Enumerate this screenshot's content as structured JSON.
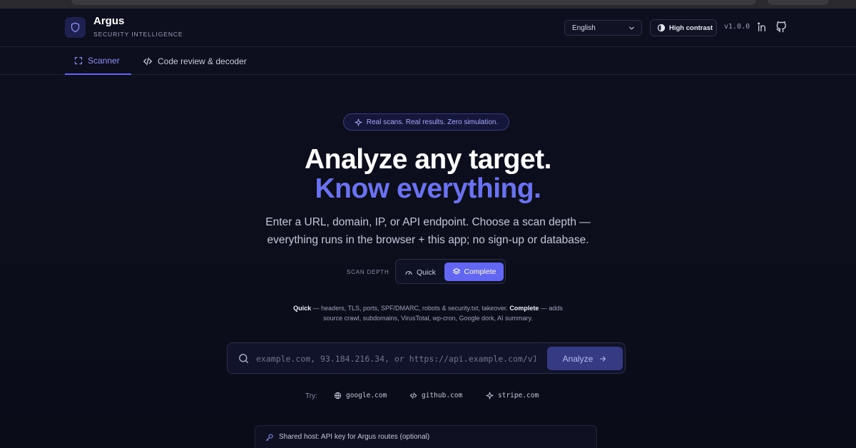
{
  "header": {
    "brand_name": "Argus",
    "brand_subtitle": "SECURITY INTELLIGENCE",
    "language": "English",
    "contrast_label": "High contrast",
    "version": "v1.0.0"
  },
  "tabs": [
    {
      "label": "Scanner",
      "active": true
    },
    {
      "label": "Code review & decoder",
      "active": false
    }
  ],
  "hero": {
    "badge": "Real scans. Real results. Zero simulation.",
    "title_line1": "Analyze any target.",
    "title_line2": "Know everything.",
    "subtitle_line1": "Enter a URL, domain, IP, or API endpoint. Choose a scan depth —",
    "subtitle_line2": "everything runs in the browser + this app; no sign-up or database."
  },
  "scan_depth": {
    "label": "SCAN DEPTH",
    "options": [
      "Quick",
      "Complete"
    ],
    "selected": "Complete",
    "desc_quick_title": "Quick",
    "desc_quick_text": " — headers, TLS, ports, SPF/DMARC, robots & security.txt, takeover. ",
    "desc_complete_title": "Complete",
    "desc_complete_text": " — adds",
    "desc_line2": "source crawl, subdomains, VirusTotal, wp-cron, Google dork, AI summary."
  },
  "search": {
    "placeholder": "example.com, 93.184.216.34, or https://api.example.com/v1",
    "value": "",
    "button_label": "Analyze"
  },
  "try": {
    "label": "Try:",
    "examples": [
      "google.com",
      "github.com",
      "stripe.com"
    ]
  },
  "shared_host": {
    "label": "Shared host: API key for Argus routes (optional)"
  },
  "colors": {
    "background": "#0b0d1a",
    "accent": "#6366f1",
    "accent_text": "#6b72ee"
  },
  "icons": {
    "brand": "shield-icon",
    "contrast": "half-circle-icon",
    "linkedin": "linkedin-icon",
    "github": "github-icon",
    "scanner_tab": "scan-frame-icon",
    "code_tab": "code-icon",
    "badge": "sparkle-icon",
    "quick": "gauge-icon",
    "complete": "layers-icon",
    "search": "search-icon",
    "analyze": "arrow-right-icon",
    "try_1": "globe-icon",
    "try_2": "code-icon",
    "try_3": "sparkle-icon",
    "shared_host": "key-icon"
  }
}
